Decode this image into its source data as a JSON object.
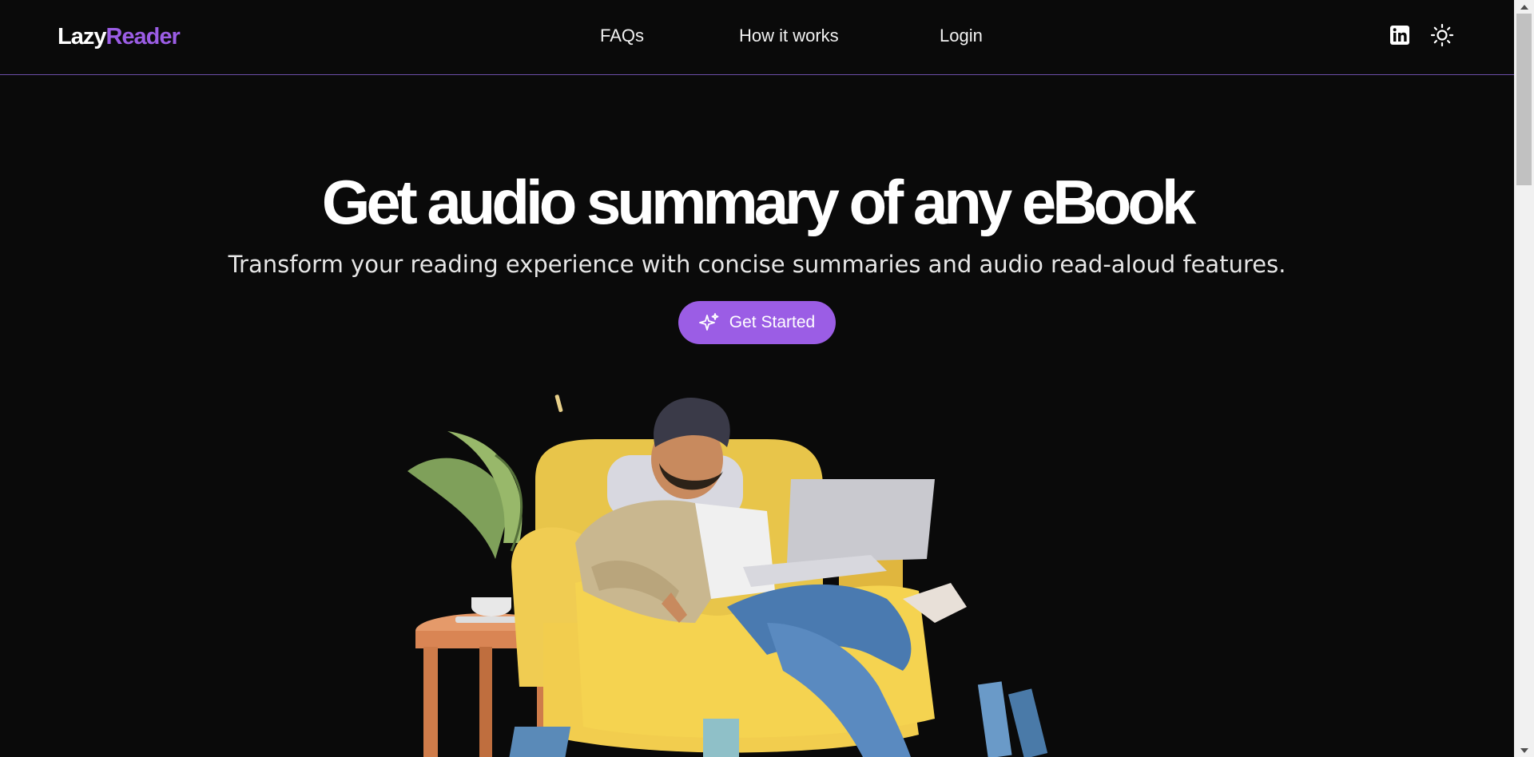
{
  "header": {
    "logo_part1": "Lazy",
    "logo_part2": "Reader",
    "nav": [
      {
        "label": "FAQs"
      },
      {
        "label": "How it works"
      },
      {
        "label": "Login"
      }
    ],
    "icons": [
      "linkedin-icon",
      "sun-icon"
    ]
  },
  "hero": {
    "title": "Get audio summary of any eBook",
    "subtitle": "Transform your reading experience with concise summaries and audio read-aloud features.",
    "cta_label": "Get Started",
    "cta_icon": "sparkles-icon",
    "illustration": "man-relaxing-in-armchair-with-laptop"
  },
  "colors": {
    "background": "#0a0a0a",
    "accent": "#9b5de5",
    "text": "#ffffff",
    "header_border": "#6b4ea8"
  }
}
